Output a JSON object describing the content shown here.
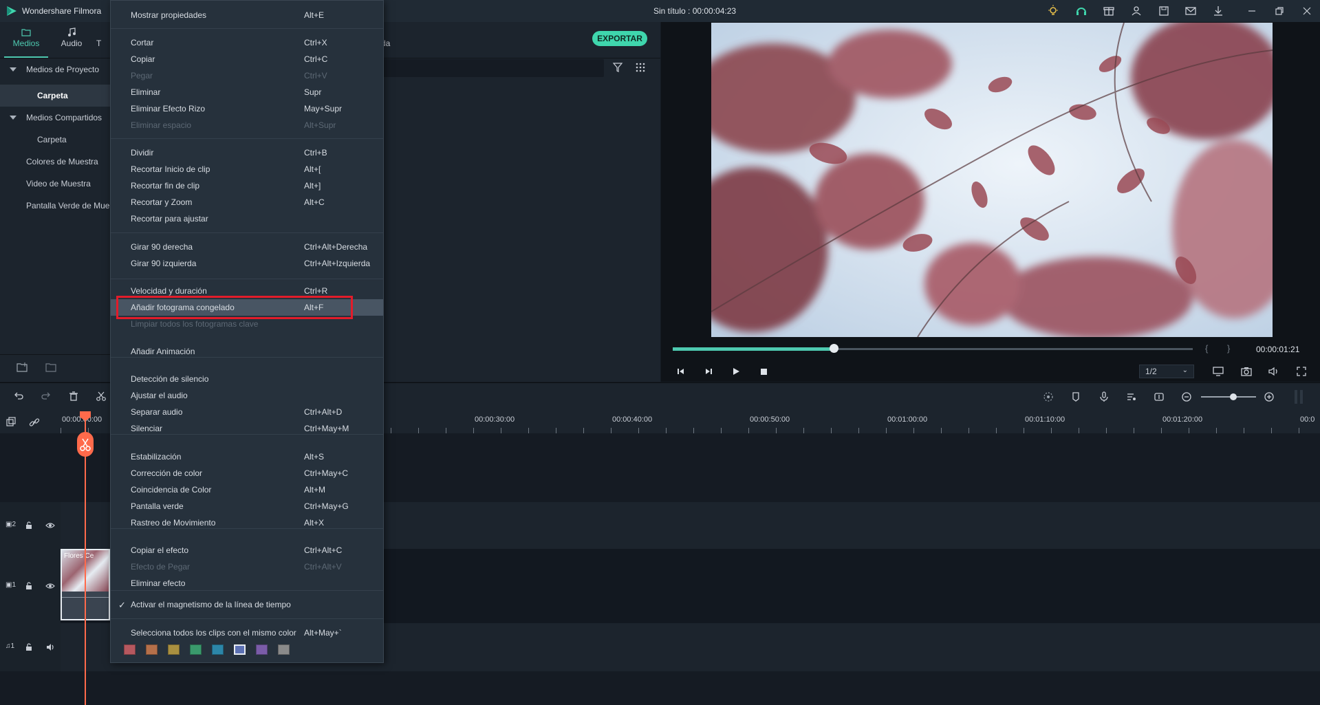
{
  "app": {
    "name": "Wondershare Filmora",
    "document_title": "Sin título : 00:00:04:23"
  },
  "media_tabs": [
    {
      "label": "Medios"
    },
    {
      "label": "Audio"
    },
    {
      "label": "T"
    }
  ],
  "media_tab_partial": "da",
  "export_label": "EXPORTAR",
  "tree": [
    {
      "label": "Medios de Proyecto"
    },
    {
      "label": "Carpeta"
    },
    {
      "label": "Medios Compartidos"
    },
    {
      "label": "Carpeta"
    },
    {
      "label": "Colores de Muestra"
    },
    {
      "label": "Video de Muestra"
    },
    {
      "label": "Pantalla Verde de Mue"
    }
  ],
  "preview": {
    "timecode": "00:00:01:21",
    "quality": "1/2",
    "progress": 0.31
  },
  "ruler": {
    "labels": [
      "00:00:00:00",
      "00:00:30:00",
      "00:00:40:00",
      "00:00:50:00",
      "00:01:00:00",
      "00:01:10:00",
      "00:01:20:00",
      "00:0"
    ]
  },
  "tracks": {
    "video2": "2",
    "video1": "1",
    "audio1": "1",
    "clip_label": "Flores Ce"
  },
  "menu": {
    "items": [
      {
        "label": "Mostrar propiedades",
        "shortcut": "Alt+E",
        "state": "normal"
      },
      {
        "label": "Cortar",
        "shortcut": "Ctrl+X",
        "state": "normal"
      },
      {
        "label": "Copiar",
        "shortcut": "Ctrl+C",
        "state": "normal"
      },
      {
        "label": "Pegar",
        "shortcut": "Ctrl+V",
        "state": "disabled"
      },
      {
        "label": "Eliminar",
        "shortcut": "Supr",
        "state": "normal"
      },
      {
        "label": "Eliminar Efecto Rizo",
        "shortcut": "May+Supr",
        "state": "normal"
      },
      {
        "label": "Eliminar espacio",
        "shortcut": "Alt+Supr",
        "state": "disabled"
      },
      {
        "label": "Dividir",
        "shortcut": "Ctrl+B",
        "state": "normal"
      },
      {
        "label": "Recortar Inicio de clip",
        "shortcut": "Alt+[",
        "state": "normal"
      },
      {
        "label": "Recortar fin de clip",
        "shortcut": "Alt+]",
        "state": "normal"
      },
      {
        "label": "Recortar y Zoom",
        "shortcut": "Alt+C",
        "state": "normal"
      },
      {
        "label": "Recortar para ajustar",
        "shortcut": "",
        "state": "normal"
      },
      {
        "label": "Girar 90 derecha",
        "shortcut": "Ctrl+Alt+Derecha",
        "state": "normal"
      },
      {
        "label": "Girar 90 izquierda",
        "shortcut": "Ctrl+Alt+Izquierda",
        "state": "normal"
      },
      {
        "label": "Velocidad y duración",
        "shortcut": "Ctrl+R",
        "state": "normal"
      },
      {
        "label": "Añadir fotograma congelado",
        "shortcut": "Alt+F",
        "state": "highlighted"
      },
      {
        "label": "Limpiar todos los fotogramas clave",
        "shortcut": "",
        "state": "disabled"
      },
      {
        "label": "Añadir Animación",
        "shortcut": "",
        "state": "normal"
      },
      {
        "label": "Detección de silencio",
        "shortcut": "",
        "state": "normal"
      },
      {
        "label": "Ajustar el audio",
        "shortcut": "",
        "state": "normal"
      },
      {
        "label": "Separar audio",
        "shortcut": "Ctrl+Alt+D",
        "state": "normal"
      },
      {
        "label": "Silenciar",
        "shortcut": "Ctrl+May+M",
        "state": "normal"
      },
      {
        "label": "Estabilización",
        "shortcut": "Alt+S",
        "state": "normal"
      },
      {
        "label": "Corrección de color",
        "shortcut": "Ctrl+May+C",
        "state": "normal"
      },
      {
        "label": "Coincidencia de Color",
        "shortcut": "Alt+M",
        "state": "normal"
      },
      {
        "label": "Pantalla verde",
        "shortcut": "Ctrl+May+G",
        "state": "normal"
      },
      {
        "label": "Rastreo de Movimiento",
        "shortcut": "Alt+X",
        "state": "normal"
      },
      {
        "label": "Copiar el efecto",
        "shortcut": "Ctrl+Alt+C",
        "state": "normal"
      },
      {
        "label": "Efecto de Pegar",
        "shortcut": "Ctrl+Alt+V",
        "state": "disabled"
      },
      {
        "label": "Eliminar efecto",
        "shortcut": "",
        "state": "normal"
      },
      {
        "label": "Activar el magnetismo de la línea de tiempo",
        "shortcut": "",
        "state": "checked"
      },
      {
        "label": "Selecciona todos los clips con el mismo color",
        "shortcut": "Alt+May+`",
        "state": "normal"
      }
    ],
    "color_swatches": [
      "#b6585f",
      "#b5704a",
      "#a99040",
      "#3a9a6c",
      "#2c86a8",
      "#5d72b4",
      "#7a5ca8",
      "#8a8a8a"
    ]
  }
}
